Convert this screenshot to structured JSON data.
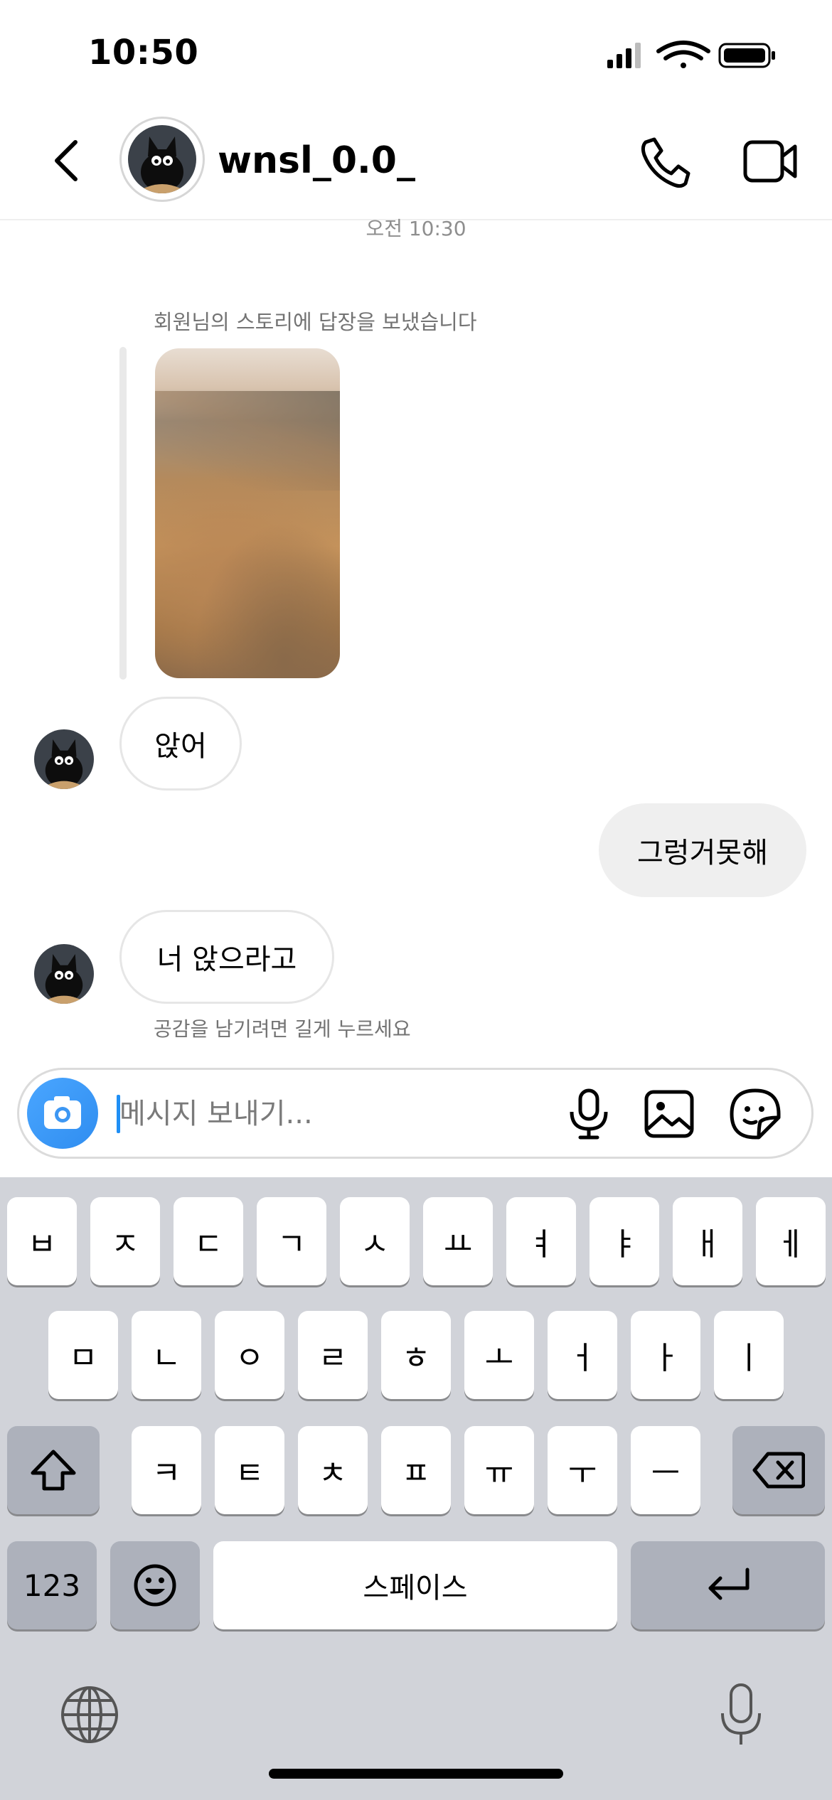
{
  "status_bar": {
    "time": "10:50"
  },
  "header": {
    "username": "wnsl_0.0_"
  },
  "chat": {
    "timestamp": "오전 10:30",
    "story_reply_note": "회원님의 스토리에 답장을 보냈습니다",
    "messages": [
      {
        "direction": "incoming",
        "text": "앉어"
      },
      {
        "direction": "outgoing",
        "text": "그렁거못해"
      },
      {
        "direction": "incoming",
        "text": "너 앉으라고"
      }
    ],
    "reaction_hint": "공감을 남기려면 길게 누르세요"
  },
  "composer": {
    "placeholder": "메시지 보내기..."
  },
  "keyboard": {
    "row1": [
      "ㅂ",
      "ㅈ",
      "ㄷ",
      "ㄱ",
      "ㅅ",
      "ㅛ",
      "ㅕ",
      "ㅑ",
      "ㅐ",
      "ㅔ"
    ],
    "row2": [
      "ㅁ",
      "ㄴ",
      "ㅇ",
      "ㄹ",
      "ㅎ",
      "ㅗ",
      "ㅓ",
      "ㅏ",
      "ㅣ"
    ],
    "row3": [
      "ㅋ",
      "ㅌ",
      "ㅊ",
      "ㅍ",
      "ㅠ",
      "ㅜ",
      "ㅡ"
    ],
    "numbers_label": "123",
    "space_label": "스페이스"
  },
  "icons": [
    "back-icon",
    "phone-icon",
    "video-camera-icon",
    "camera-icon",
    "microphone-icon",
    "gallery-icon",
    "sticker-icon",
    "shift-icon",
    "backspace-icon",
    "emoji-icon",
    "return-icon",
    "globe-icon",
    "dictation-icon"
  ],
  "colors": {
    "accent_blue": "#1f8ff5",
    "bubble_outgoing": "#efefef",
    "keyboard_bg": "#d1d3d9"
  }
}
